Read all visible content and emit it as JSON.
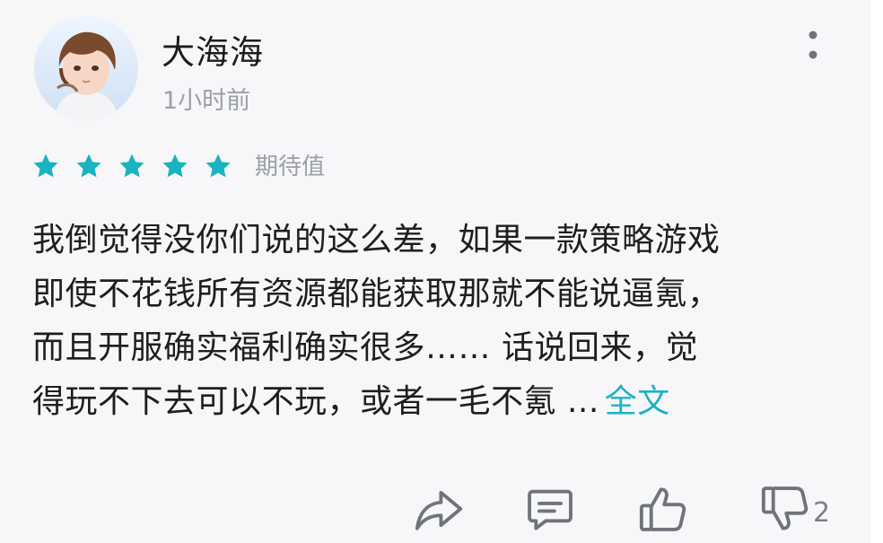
{
  "review": {
    "author": "大海海",
    "time": "1小时前",
    "rating": 5,
    "rating_label": "期待值",
    "lines": [
      "我倒觉得没你们说的这么差，如果一款策略游戏",
      "即使不花钱所有资源都能获取那就不能说逼氪，",
      "而且开服确实福利确实很多…… 话说回来，觉",
      "得玩不下去可以不玩，或者一毛不氪 ..."
    ],
    "full_text_link": "全文"
  },
  "actions": {
    "share_icon": "share-icon",
    "comment_icon": "comment-icon",
    "like_icon": "thumbs-up-icon",
    "dislike_icon": "thumbs-down-icon",
    "dislike_count": "2"
  },
  "colors": {
    "accent": "#19b3c1",
    "star": "#19b3c1",
    "icon": "#6f747c"
  }
}
